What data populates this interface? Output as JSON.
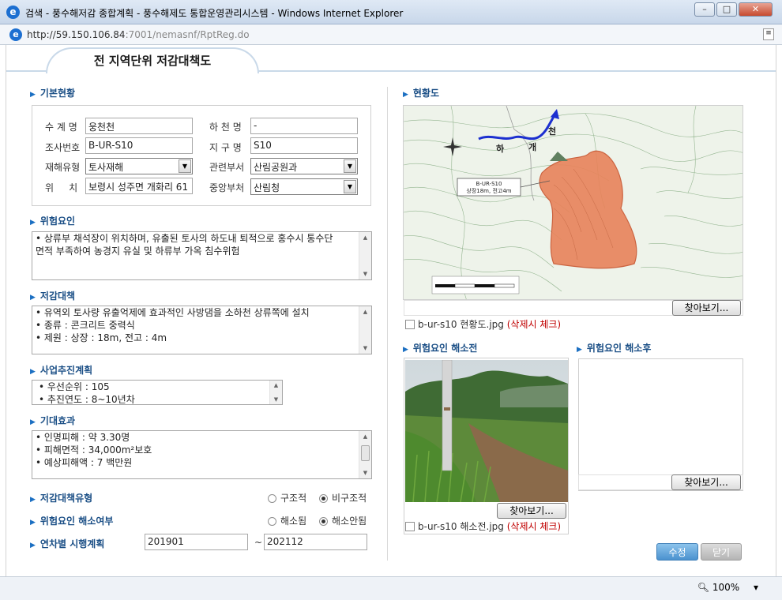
{
  "window": {
    "title": "검색 - 풍수해저감 종합계획 - 풍수해제도 통합운영관리시스템 - Windows Internet Explorer",
    "url_host": "http://59.150.106.84",
    "url_path": ":7001/nemasnf/RptReg.do",
    "zoom": "100%"
  },
  "tab": {
    "label": "전 지역단위 저감대책도"
  },
  "basic": {
    "section": "기본현황",
    "label_watershed": "수 계 명",
    "value_watershed": "웅천천",
    "label_river": "하 천 명",
    "value_river": "-",
    "label_survey_no": "조사번호",
    "value_survey_no": "B-UR-S10",
    "label_district": "지 구 명",
    "value_district": "S10",
    "label_disaster_type": "재해유형",
    "value_disaster_type": "토사재해",
    "label_dept": "관련부서",
    "value_dept": "산림공원과",
    "label_location": "위     치",
    "value_location": "보령시 성주면 개화리 61",
    "label_central": "중앙부처",
    "value_central": "산림청"
  },
  "risk": {
    "section": "위험요인",
    "lines": [
      "• 상류부 채석장이 위치하며, 유출된 토사의 하도내 퇴적으로 홍수시 통수단",
      "면적 부족하여 농경지 유실 및 하류부 가옥 침수위험"
    ]
  },
  "measures": {
    "section": "저감대책",
    "lines": [
      "• 유역외 토사량 유출억제에 효과적인 사방댐을 소하천 상류쪽에 설치",
      "• 종류 : 콘크리트 중력식",
      "• 제원 : 상장 : 18m, 전고 : 4m"
    ]
  },
  "plan": {
    "section": "사업추진계획",
    "lines": [
      "• 우선순위  : 105",
      "• 추진연도  : 8~10년차"
    ]
  },
  "effect": {
    "section": "기대효과",
    "lines": [
      "• 인명피해 : 약 3.30명",
      "• 피해면적 : 34,000m²보호",
      "• 예상피해액 : 7 백만원"
    ]
  },
  "type_row": {
    "label": "저감대책유형",
    "opt1": "구조적",
    "opt2": "비구조적",
    "selected": "비구조적"
  },
  "resolved_row": {
    "label": "위험요인 해소여부",
    "opt1": "해소됨",
    "opt2": "해소안됨",
    "selected": "해소안됨"
  },
  "schedule": {
    "label": "연차별 시행계획",
    "from": "201901",
    "sep": "~",
    "to": "202112"
  },
  "map": {
    "section": "현황도",
    "label_stream1": "하",
    "label_stream2": "개",
    "label_stream3": "천",
    "callout_line1": "B-UR-S10",
    "callout_line2": "상장18m, 전고4m",
    "browse": "찾아보기...",
    "file": "b-ur-s10 현황도.jpg",
    "file_note": "(삭제시 체크)"
  },
  "before": {
    "section": "위험요인 해소전",
    "browse": "찾아보기...",
    "file": "b-ur-s10 해소전.jpg",
    "file_note": "(삭제시 체크)"
  },
  "after": {
    "section": "위험요인 해소후",
    "browse": "찾아보기..."
  },
  "actions": {
    "edit": "수정",
    "close": "닫기"
  },
  "colors": {
    "accent": "#1b4f86",
    "edit_button": "#5aa0d8",
    "close_button": "#bdbdbd",
    "risk_area": "#e8835a"
  }
}
